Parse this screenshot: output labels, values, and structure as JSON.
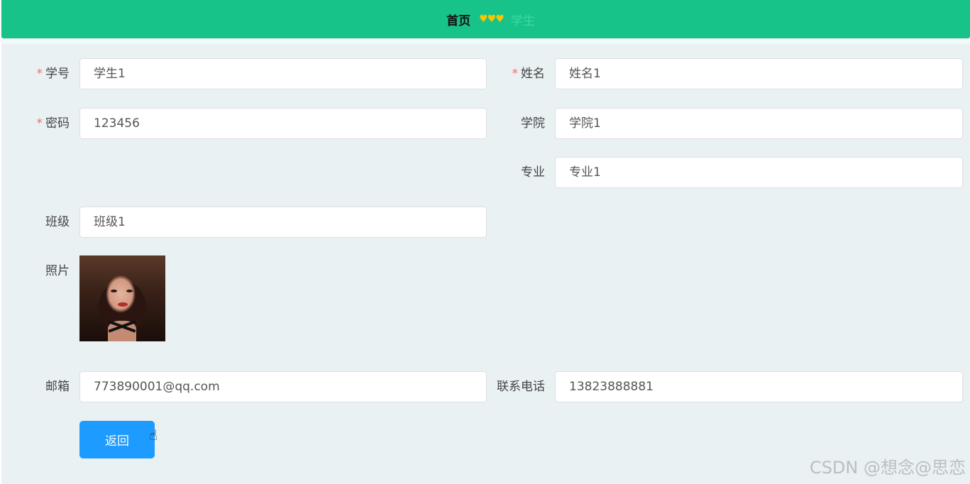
{
  "breadcrumb": {
    "home": "首页",
    "separator": "♥♥♥",
    "current": "学生"
  },
  "form": {
    "student_id": {
      "label": "学号",
      "required": true,
      "value": "学生1"
    },
    "name": {
      "label": "姓名",
      "required": true,
      "value": "姓名1"
    },
    "password": {
      "label": "密码",
      "required": true,
      "value": "123456"
    },
    "college": {
      "label": "学院",
      "value": "学院1"
    },
    "major": {
      "label": "专业",
      "value": "专业1"
    },
    "class": {
      "label": "班级",
      "value": "班级1"
    },
    "photo": {
      "label": "照片"
    },
    "email": {
      "label": "邮箱",
      "value": "773890001@qq.com"
    },
    "phone": {
      "label": "联系电话",
      "value": "13823888881"
    }
  },
  "buttons": {
    "back": "返回"
  },
  "watermark": "CSDN @想念@思恋",
  "colors": {
    "header": "#18c389",
    "content_bg": "#e9f1f3",
    "button": "#1e9bff",
    "required": "#f56c6c"
  }
}
